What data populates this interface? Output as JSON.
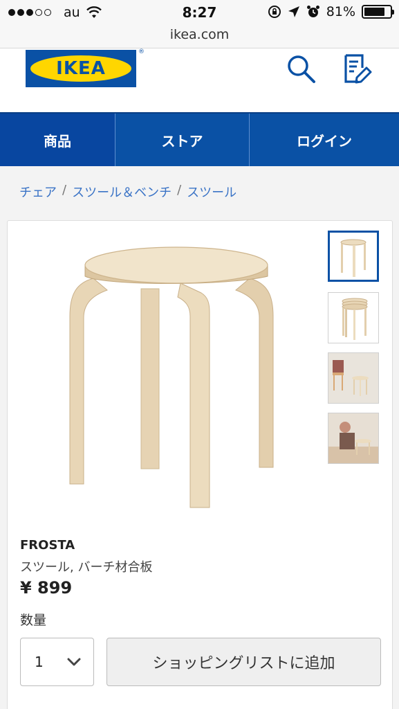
{
  "status_bar": {
    "carrier": "au",
    "time": "8:27",
    "battery": "81%",
    "battery_level": 0.81
  },
  "browser": {
    "url": "ikea.com"
  },
  "header": {
    "logo_text": "IKEA",
    "logo_mark": "®",
    "icons": [
      "search-icon",
      "shopping-list-icon"
    ],
    "colors": {
      "brand_blue": "#0a51a5",
      "brand_yellow": "#ffd600"
    }
  },
  "nav": {
    "items": [
      {
        "label": "商品"
      },
      {
        "label": "ストア"
      },
      {
        "label": "ログイン"
      }
    ]
  },
  "breadcrumb": [
    "チェア",
    "スツール＆ベンチ",
    "スツール"
  ],
  "product": {
    "name": "FROSTA",
    "description": "スツール, バーチ材合板",
    "price": "¥ 899",
    "quantity_label": "数量",
    "quantity_value": "1",
    "add_button": "ショッピングリストに追加"
  }
}
